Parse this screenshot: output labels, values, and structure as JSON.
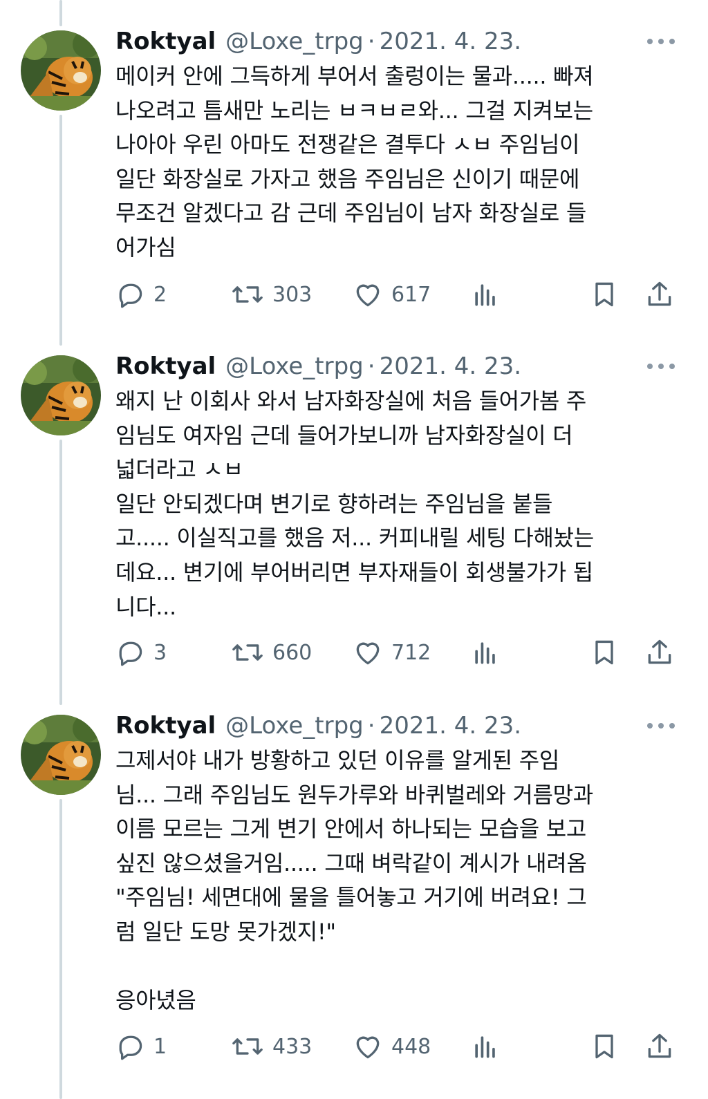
{
  "tweets": [
    {
      "name": "Roktyal",
      "handle": "@Loxe_trpg",
      "date": "2021. 4. 23.",
      "text": "메이커 안에 그득하게 부어서 출렁이는 물과..... 빠져\n나오려고 틈새만 노리는 ㅂㅋㅂㄹ와... 그걸 지켜보는\n나아아 우린 아마도 전쟁같은 결투다 ㅅㅂ 주임님이\n일단 화장실로 가자고 했음 주임님은 신이기 때문에\n무조건 알겠다고 감 근데 주임님이 남자 화장실로 들\n어가심",
      "replies": "2",
      "retweets": "303",
      "likes": "617"
    },
    {
      "name": "Roktyal",
      "handle": "@Loxe_trpg",
      "date": "2021. 4. 23.",
      "text": "왜지 난 이회사 와서 남자화장실에 처음 들어가봄 주\n임님도 여자임 근데 들어가보니까 남자화장실이 더\n넓더라고 ㅅㅂ\n일단 안되겠다며 변기로 향하려는 주임님을 붙들\n고..... 이실직고를 했음 저... 커피내릴 세팅 다해놨는\n데요... 변기에 부어버리면 부자재들이 회생불가가 됩\n니다...",
      "replies": "3",
      "retweets": "660",
      "likes": "712"
    },
    {
      "name": "Roktyal",
      "handle": "@Loxe_trpg",
      "date": "2021. 4. 23.",
      "text": "그제서야 내가 방황하고 있던 이유를 알게된 주임\n님... 그래 주임님도 원두가루와 바퀴벌레와 거름망과\n이름 모르는 그게 변기 안에서 하나되는 모습을 보고\n싶진 않으셨을거임..... 그때 벼락같이 계시가 내려옴\n\"주임님! 세면대에 물을 틀어놓고 거기에 버려요! 그\n럼 일단 도망 못가겠지!\"\n\n응아녔음",
      "replies": "1",
      "retweets": "433",
      "likes": "448"
    }
  ],
  "separator": "·",
  "icons": {
    "reply": "reply-icon",
    "retweet": "retweet-icon",
    "like": "heart-icon",
    "views": "analytics-icon",
    "bookmark": "bookmark-icon",
    "share": "share-icon",
    "more": "more-icon"
  },
  "colors": {
    "text": "#0f1419",
    "secondary": "#536471",
    "thread_line": "#cfd9de"
  }
}
